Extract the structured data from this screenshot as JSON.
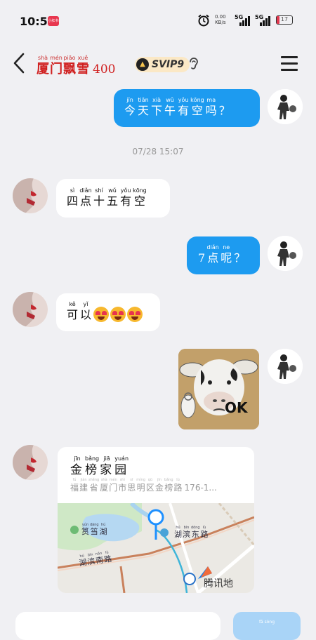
{
  "status_bar": {
    "time": "10:57",
    "app_badge": "小红书",
    "net_speed": "0.00",
    "net_unit": "KB/s",
    "signal1": "5G",
    "signal2": "5G",
    "battery": "17"
  },
  "header": {
    "title_chars": [
      {
        "py": "shà",
        "hz": "厦"
      },
      {
        "py": "mén",
        "hz": "门"
      },
      {
        "py": "piāo",
        "hz": "飘"
      },
      {
        "py": "xuě",
        "hz": "雪"
      }
    ],
    "title_number": "400",
    "vip_label": "SVIP9",
    "ear_icon": "ear-icon",
    "menu_icon": "hamburger-menu-icon"
  },
  "messages": {
    "m1": [
      {
        "py": "jīn",
        "hz": "今"
      },
      {
        "py": "tiān",
        "hz": "天"
      },
      {
        "py": "xià",
        "hz": "下"
      },
      {
        "py": "wǔ",
        "hz": "午"
      },
      {
        "py": "yǒu",
        "hz": "有"
      },
      {
        "py": "kōng",
        "hz": "空"
      },
      {
        "py": "ma",
        "hz": "吗"
      },
      {
        "py": "",
        "hz": "？"
      }
    ],
    "timestamp": "07/28 15:07",
    "m2": [
      {
        "py": "sì",
        "hz": "四"
      },
      {
        "py": "diǎn",
        "hz": "点"
      },
      {
        "py": "shí",
        "hz": "十"
      },
      {
        "py": "wǔ",
        "hz": "五"
      },
      {
        "py": "yǒu",
        "hz": "有"
      },
      {
        "py": "kōng",
        "hz": "空"
      }
    ],
    "m3_prefix": "7",
    "m3": [
      {
        "py": "diǎn",
        "hz": "点"
      },
      {
        "py": "ne",
        "hz": "呢"
      },
      {
        "py": "",
        "hz": "？"
      }
    ],
    "m4": [
      {
        "py": "kě",
        "hz": "可"
      },
      {
        "py": "yǐ",
        "hz": "以"
      }
    ],
    "m4_emoji_icon": "heart-eyes-emoji-icon",
    "sticker_text": "OK"
  },
  "location": {
    "name": [
      {
        "py": "jīn",
        "hz": "金"
      },
      {
        "py": "bǎng",
        "hz": "榜"
      },
      {
        "py": "jiā",
        "hz": "家"
      },
      {
        "py": "yuán",
        "hz": "园"
      }
    ],
    "address": [
      {
        "py": "fú",
        "hz": "福"
      },
      {
        "py": "jiàn",
        "hz": "建"
      },
      {
        "py": "shěng",
        "hz": "省"
      },
      {
        "py": "shà",
        "hz": "厦"
      },
      {
        "py": "mén",
        "hz": "门"
      },
      {
        "py": "shì",
        "hz": "市"
      },
      {
        "py": "sī",
        "hz": "思"
      },
      {
        "py": "míng",
        "hz": "明"
      },
      {
        "py": "qū",
        "hz": "区"
      },
      {
        "py": "jīn",
        "hz": "金"
      },
      {
        "py": "bǎng",
        "hz": "榜"
      },
      {
        "py": "lù",
        "hz": "路"
      }
    ],
    "address_tail": "176-1...",
    "map_labels": {
      "lake": [
        {
          "py": "yún",
          "hz": "筼"
        },
        {
          "py": "dāng",
          "hz": "筜"
        },
        {
          "py": "hú",
          "hz": "湖"
        }
      ],
      "east_road": [
        {
          "py": "hú",
          "hz": "湖"
        },
        {
          "py": "bīn",
          "hz": "滨"
        },
        {
          "py": "dōng",
          "hz": "东"
        },
        {
          "py": "lù",
          "hz": "路"
        }
      ],
      "south_road": [
        {
          "py": "hú",
          "hz": "湖"
        },
        {
          "py": "bīn",
          "hz": "滨"
        },
        {
          "py": "nán",
          "hz": "南"
        },
        {
          "py": "lù",
          "hz": "路"
        }
      ]
    },
    "map_brand": "腾讯地"
  },
  "input": {
    "send_label": "fā sòng"
  }
}
